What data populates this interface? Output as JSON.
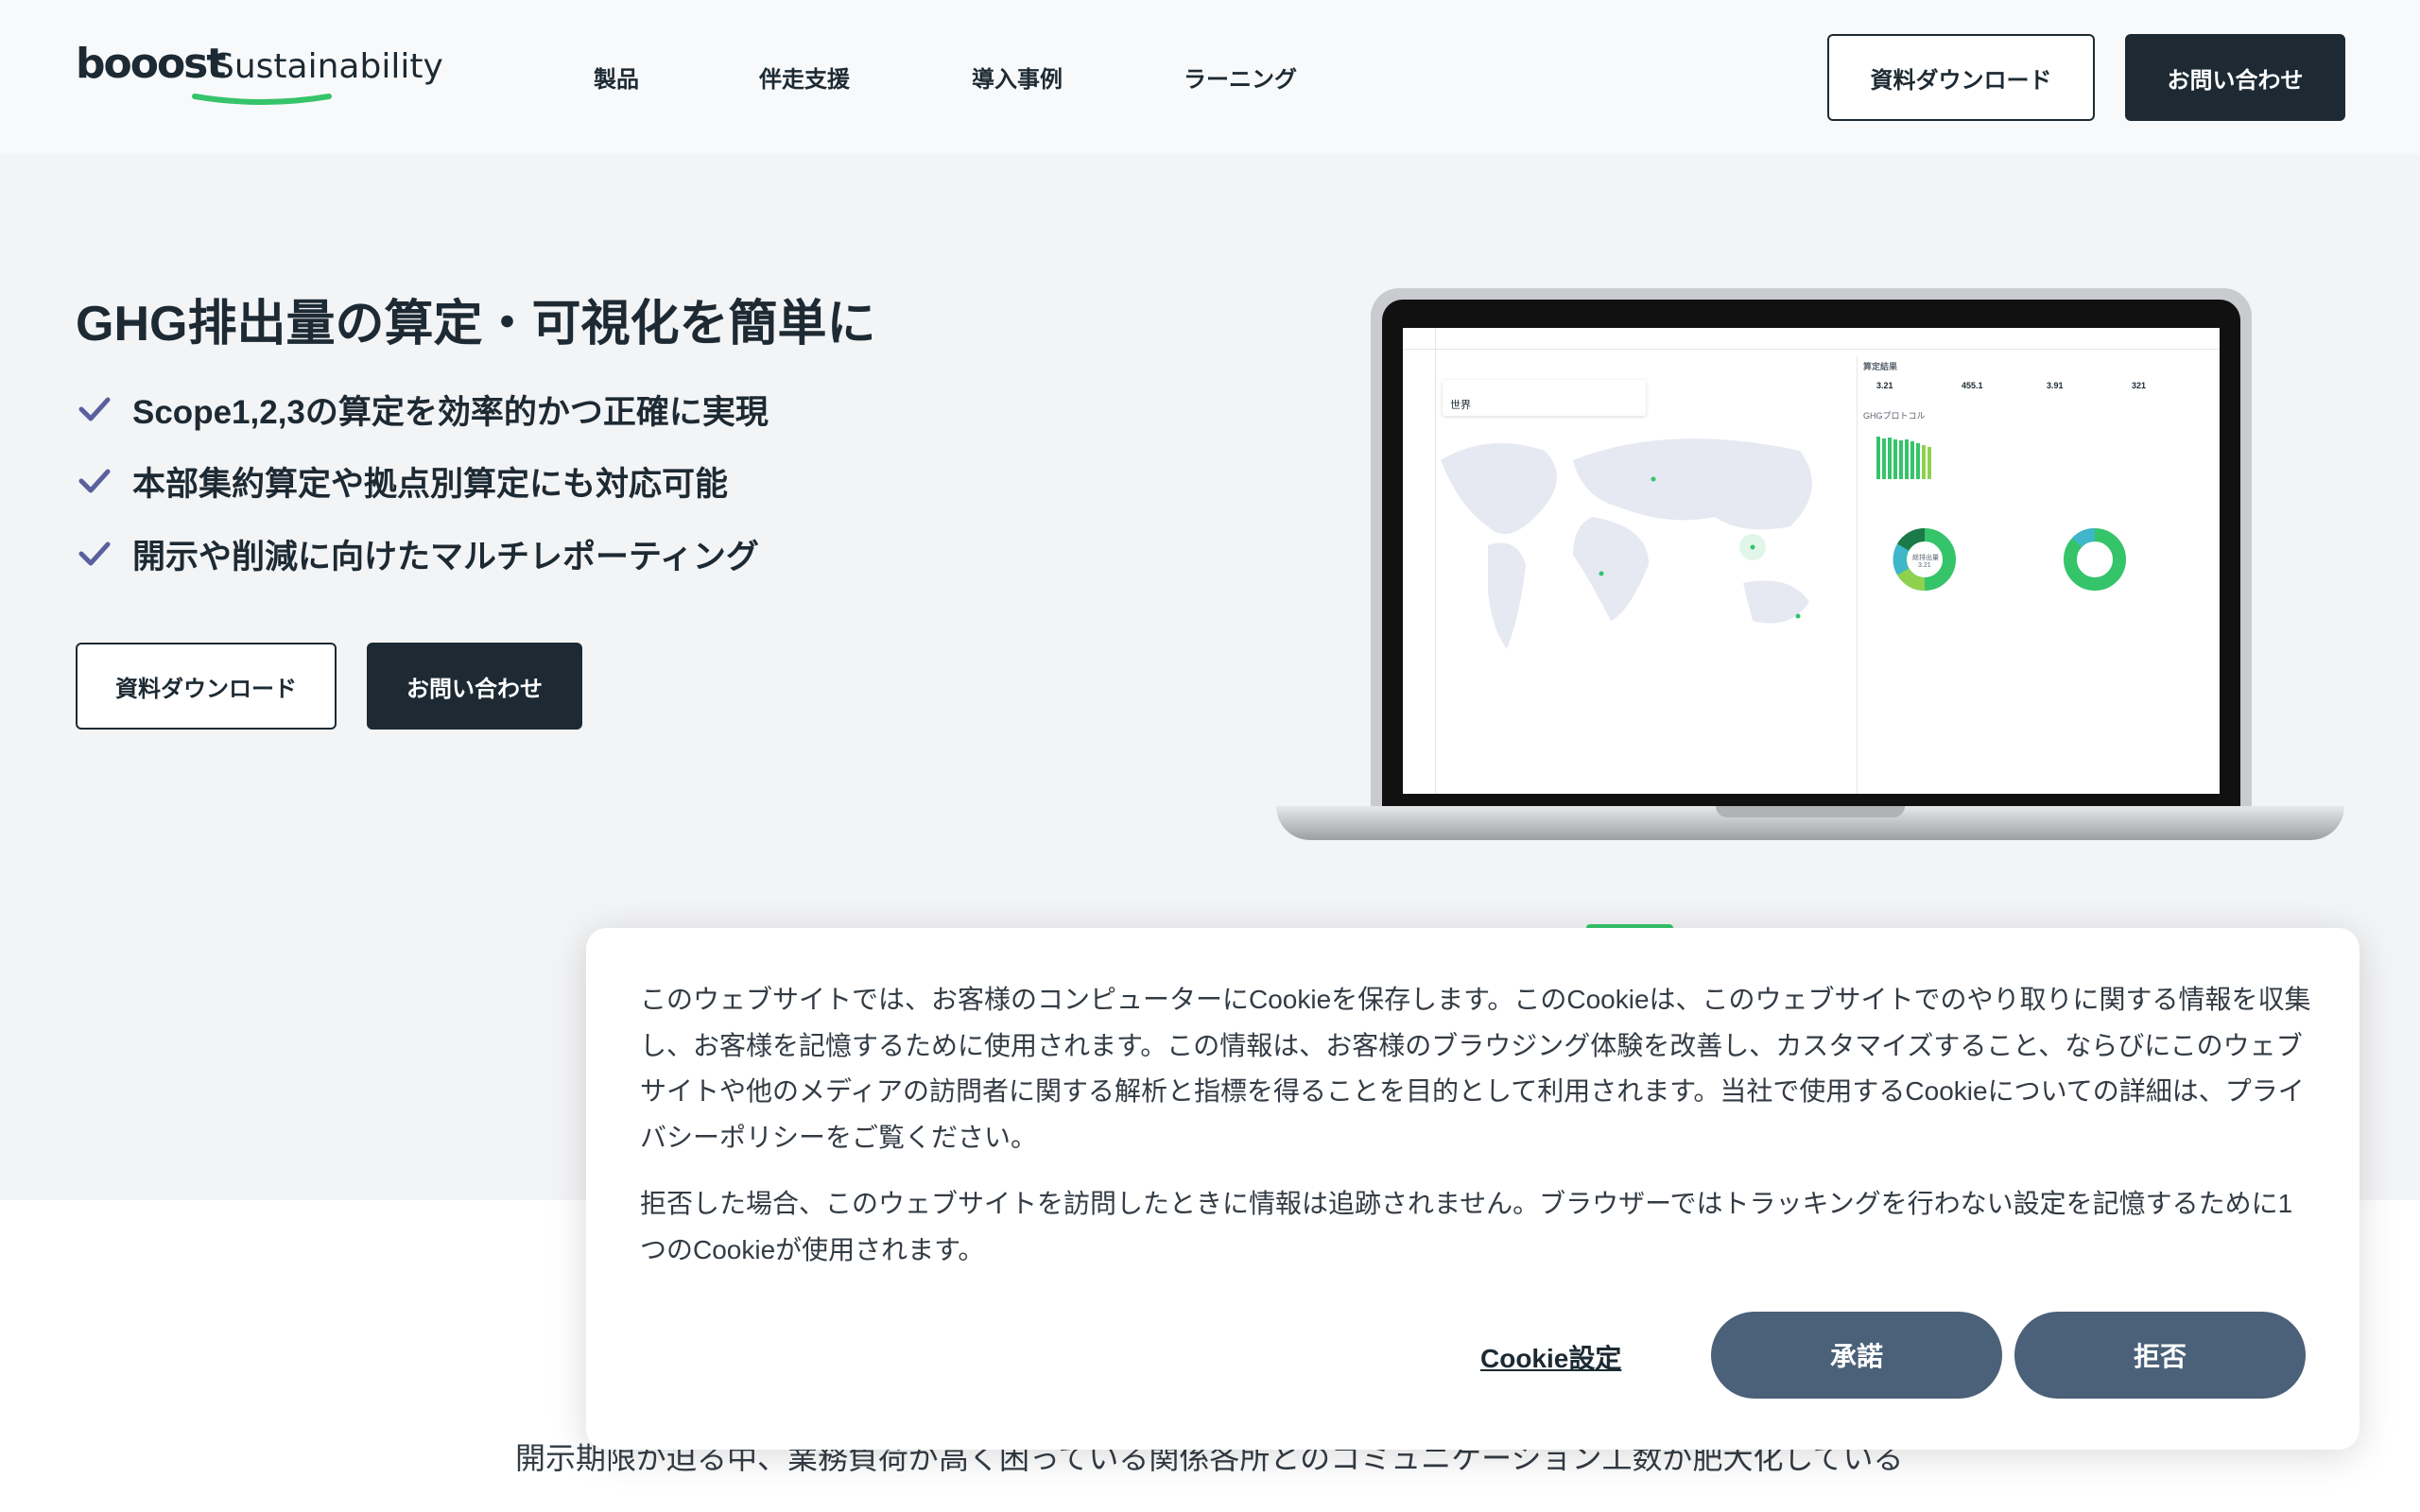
{
  "header": {
    "logo_main": "booost",
    "logo_sub": "Sustainability",
    "nav": [
      "製品",
      "伴走支援",
      "導入事例",
      "ラーニング"
    ],
    "download_label": "資料ダウンロード",
    "contact_label": "お問い合わせ"
  },
  "hero": {
    "title": "GHG排出量の算定・可視化を簡単に",
    "features": [
      "Scope1,2,3の算定を効率的かつ正確に実現",
      "本部集約算定や拠点別算定にも対応可能",
      "開示や削減に向けたマルチレポーティング"
    ],
    "download_label": "資料ダウンロード",
    "contact_label": "お問い合わせ"
  },
  "screen": {
    "region_label": "世界",
    "summary_title": "算定結果",
    "stats": [
      "3.21",
      "455.1",
      "3.91",
      "321"
    ],
    "section_title": "GHGプロトコル",
    "donut_center": "総排出量",
    "donut_value": "3.21"
  },
  "cookie": {
    "paragraph1": "このウェブサイトでは、お客様のコンピューターにCookieを保存します。このCookieは、このウェブサイトでのやり取りに関する情報を収集し、お客様を記憶するために使用されます。この情報は、お客様のブラウジング体験を改善し、カスタマイズすること、ならびにこのウェブサイトや他のメディアの訪問者に関する解析と指標を得ることを目的として利用されます。当社で使用するCookieについての詳細は、プライバシーポリシーをご覧ください。",
    "paragraph2": "拒否した場合、このウェブサイトを訪問したときに情報は追跡されません。ブラウザーではトラッキングを行わない設定を記憶するために1つのCookieが使用されます。",
    "settings_label": "Cookie設定",
    "accept_label": "承諾",
    "reject_label": "拒否"
  },
  "bottom_text": "開示期限が迫る中、業務負荷が高く困っている関係各所とのコミュニケーション工数が肥大化している",
  "colors": {
    "dark": "#1d2a33",
    "accent_green": "#35c46a",
    "cookie_button": "#4b6079",
    "check": "#5a5f9e"
  }
}
